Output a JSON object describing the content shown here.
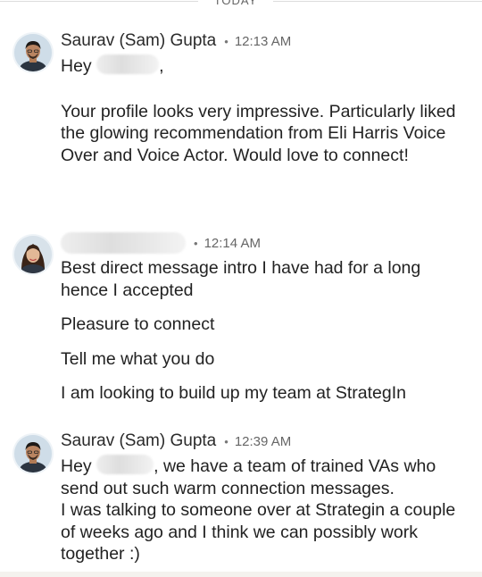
{
  "divider": {
    "label": "TODAY"
  },
  "messages": [
    {
      "sender": "Saurav (Sam) Gupta",
      "time": "12:13 AM",
      "greeting_prefix": "Hey",
      "greeting_suffix": ",",
      "paragraphs": [
        "Your profile looks very impressive. Particularly liked the glowing recommendation from Eli Harris Voice Over and Voice Actor. Would love to connect!"
      ]
    },
    {
      "sender": "",
      "time": "12:14 AM",
      "paragraphs": [
        "Best direct message intro I have had for a long hence I accepted",
        "Pleasure to connect",
        "Tell me what you do",
        "I am looking to build up my team at StrategIn"
      ]
    },
    {
      "sender": "Saurav (Sam) Gupta",
      "time": "12:39 AM",
      "greeting_prefix": "Hey",
      "greeting_suffix": ", we have a team of trained VAs who send out such warm connection messages.",
      "paragraphs": [
        "I was talking to someone over at Strategin a couple of weeks ago and I think we can possibly work together :)"
      ]
    }
  ],
  "colors": {
    "text": "#222222",
    "meta": "#666666",
    "divider": "#dcdcdc"
  },
  "icons": {
    "avatar_male": "person-avatar",
    "avatar_female": "person-avatar"
  }
}
